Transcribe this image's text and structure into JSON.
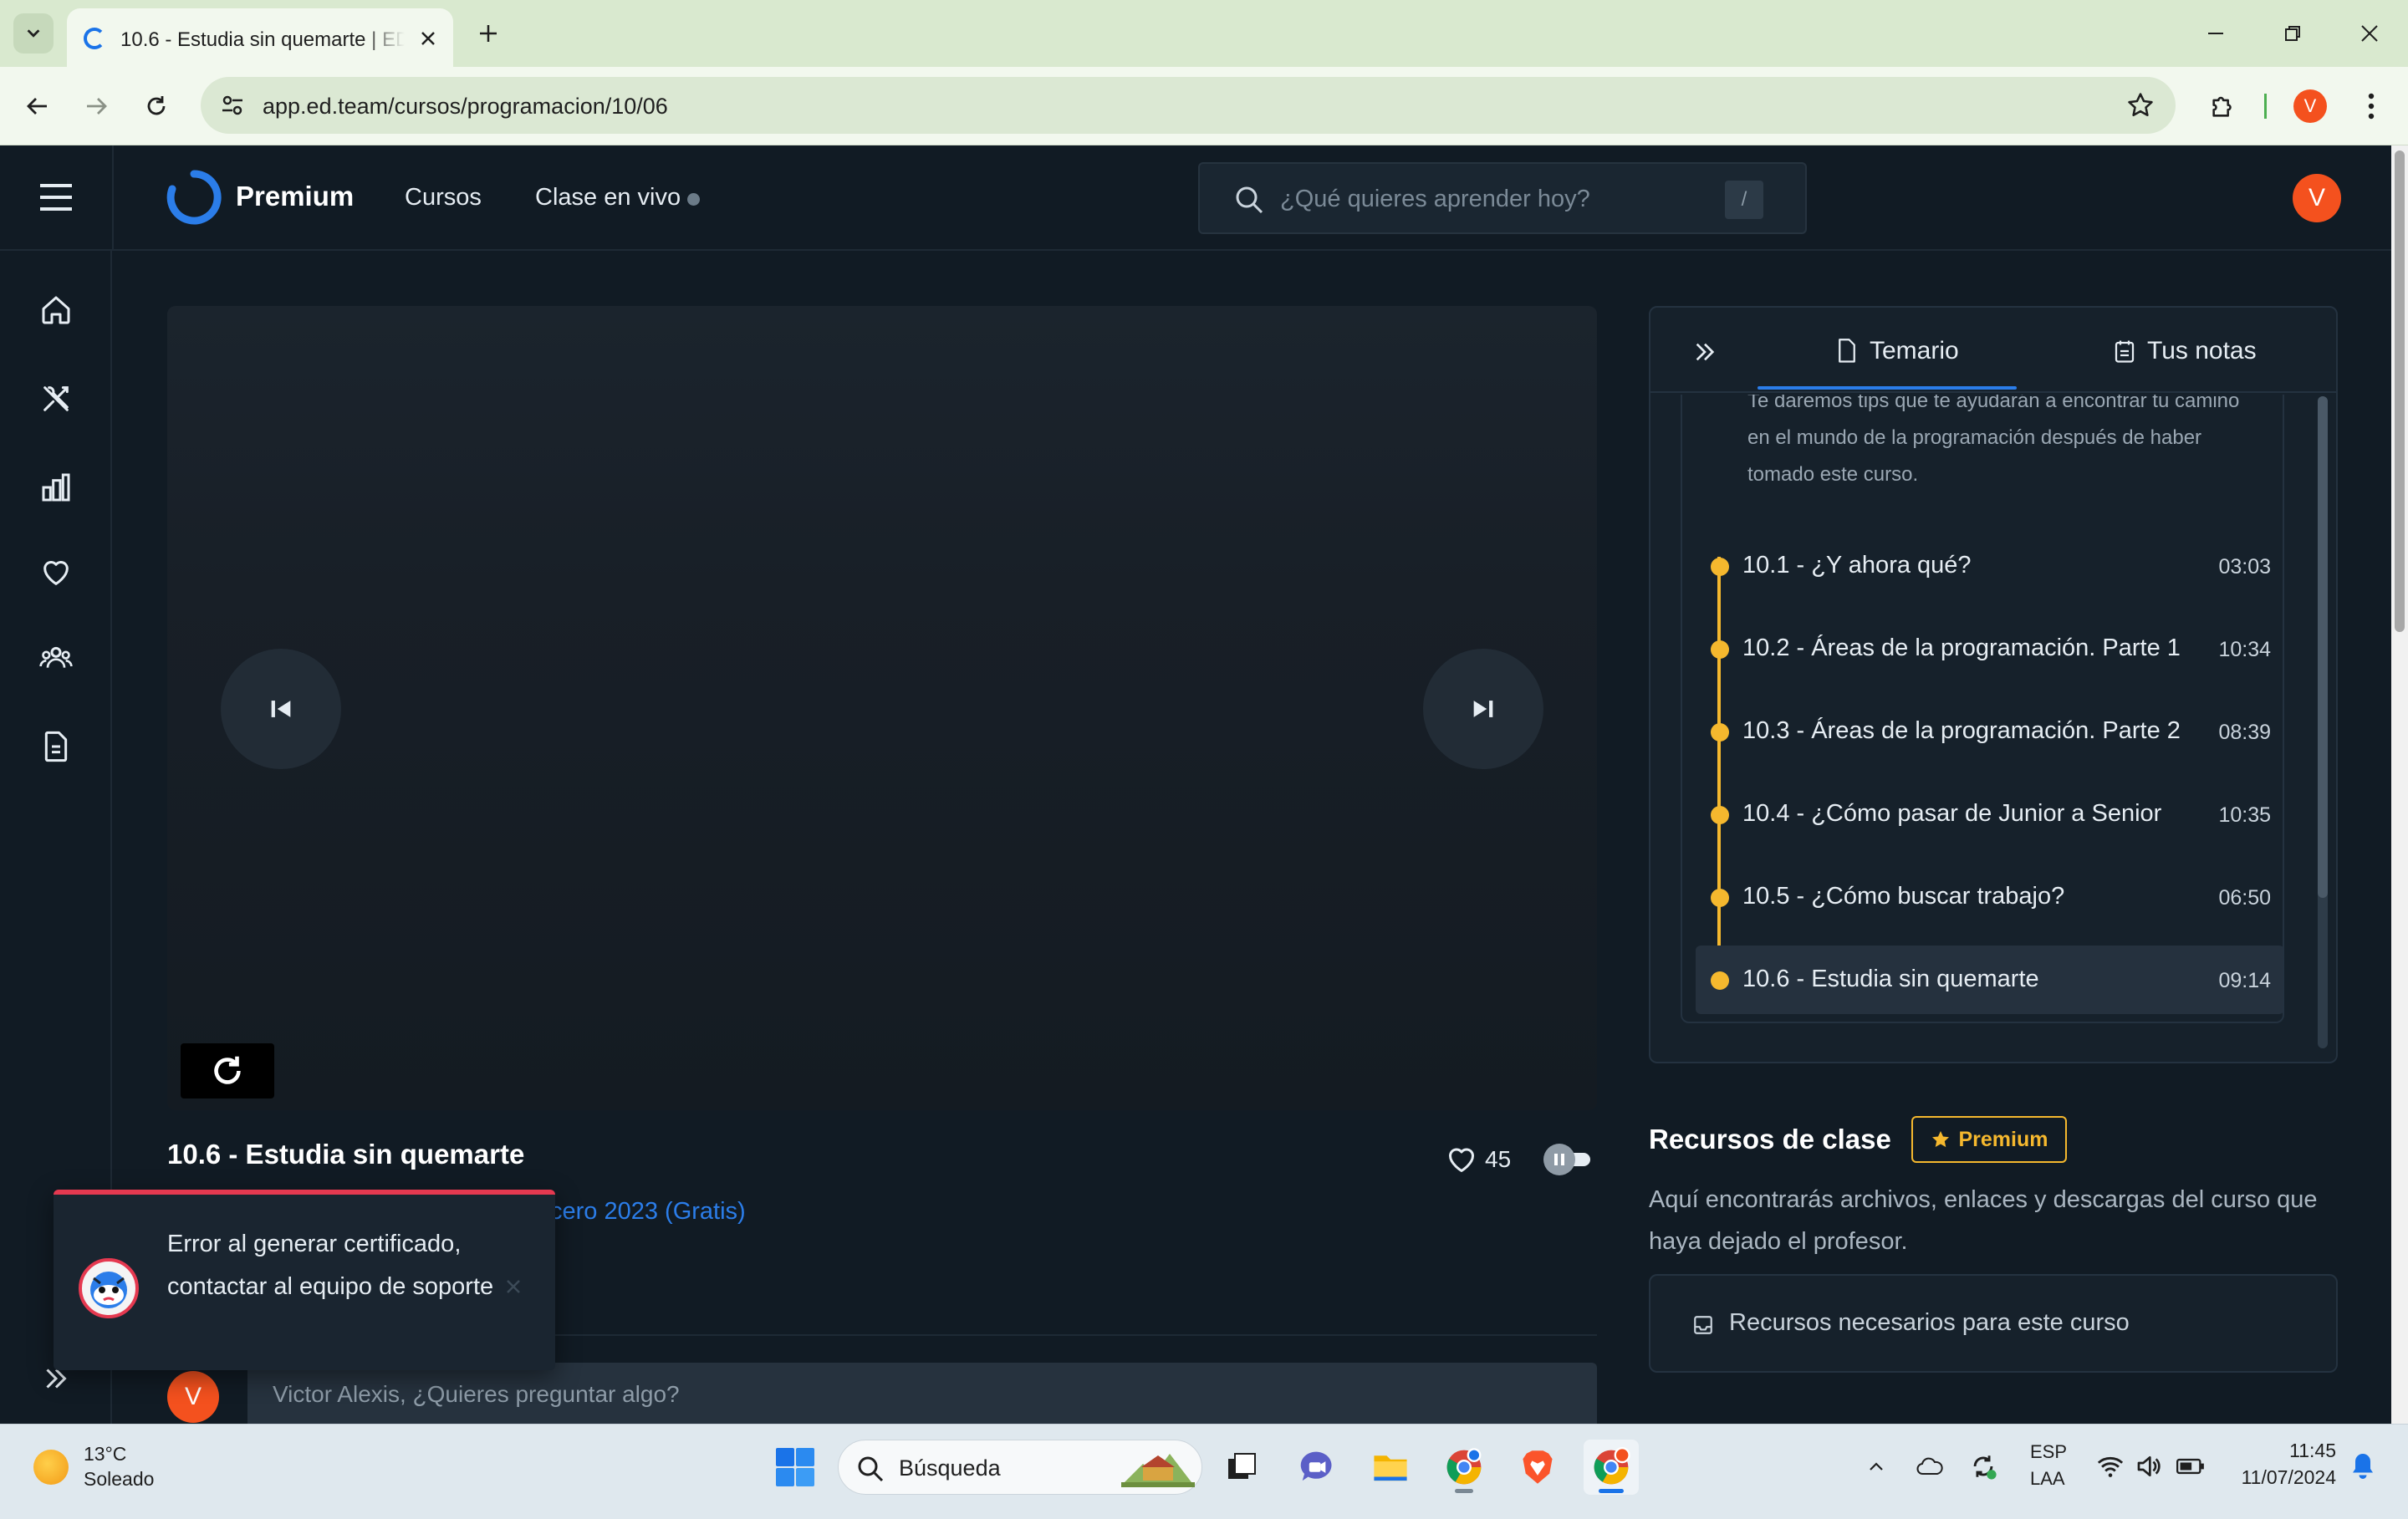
{
  "browser": {
    "tab_title": "10.6 - Estudia sin quemarte | ED",
    "url": "app.ed.team/cursos/programacion/10/06",
    "profile_initial": "V"
  },
  "header": {
    "logo_text": "Premium",
    "nav": {
      "courses": "Cursos",
      "live": "Clase en vivo"
    },
    "search_placeholder": "¿Qué quieres aprender hoy?",
    "search_shortcut": "/",
    "avatar_initial": "V"
  },
  "sidebar": {
    "icons": [
      "home-icon",
      "tools-icon",
      "stats-icon",
      "heart-icon",
      "community-icon",
      "document-icon"
    ]
  },
  "player": {
    "class_title": "10.6 - Estudia sin quemarte",
    "likes": "45",
    "course_link_text": "cero 2023 (Gratis)"
  },
  "toast": {
    "message": "Error al generar certificado, contactar al equipo de soporte"
  },
  "comment": {
    "avatar_initial": "V",
    "placeholder": "Victor Alexis, ¿Quieres preguntar algo?"
  },
  "syllabus": {
    "tabs": {
      "syllabus": "Temario",
      "notes": "Tus notas"
    },
    "section_description": "Te daremos tips que te ayudarán a encontrar tu camino en el mundo de la programación después de haber tomado este curso.",
    "lessons": [
      {
        "title": "10.1 - ¿Y ahora qué?",
        "duration": "03:03"
      },
      {
        "title": "10.2 - Áreas de la programación. Parte 1",
        "duration": "10:34"
      },
      {
        "title": "10.3 - Áreas de la programación. Parte 2",
        "duration": "08:39"
      },
      {
        "title": "10.4 - ¿Cómo pasar de Junior a Senior",
        "duration": "10:35"
      },
      {
        "title": "10.5 - ¿Cómo buscar trabajo?",
        "duration": "06:50"
      },
      {
        "title": "10.6 - Estudia sin quemarte",
        "duration": "09:14"
      }
    ],
    "active_index": 5
  },
  "resources": {
    "title": "Recursos de clase",
    "badge": "Premium",
    "description": "Aquí encontrarás archivos, enlaces y descargas del curso que haya dejado el profesor.",
    "box_label": "Recursos necesarios para este curso"
  },
  "taskbar": {
    "weather_temp": "13°C",
    "weather_desc": "Soleado",
    "search_label": "Búsqueda",
    "lang_top": "ESP",
    "lang_bottom": "LAA",
    "time": "11:45",
    "date": "11/07/2024"
  },
  "colors": {
    "accent_blue": "#2b7de9",
    "lesson_yellow": "#f5b82e",
    "error_red": "#e53950",
    "avatar_orange": "#f4511e",
    "app_background": "#111b24"
  }
}
